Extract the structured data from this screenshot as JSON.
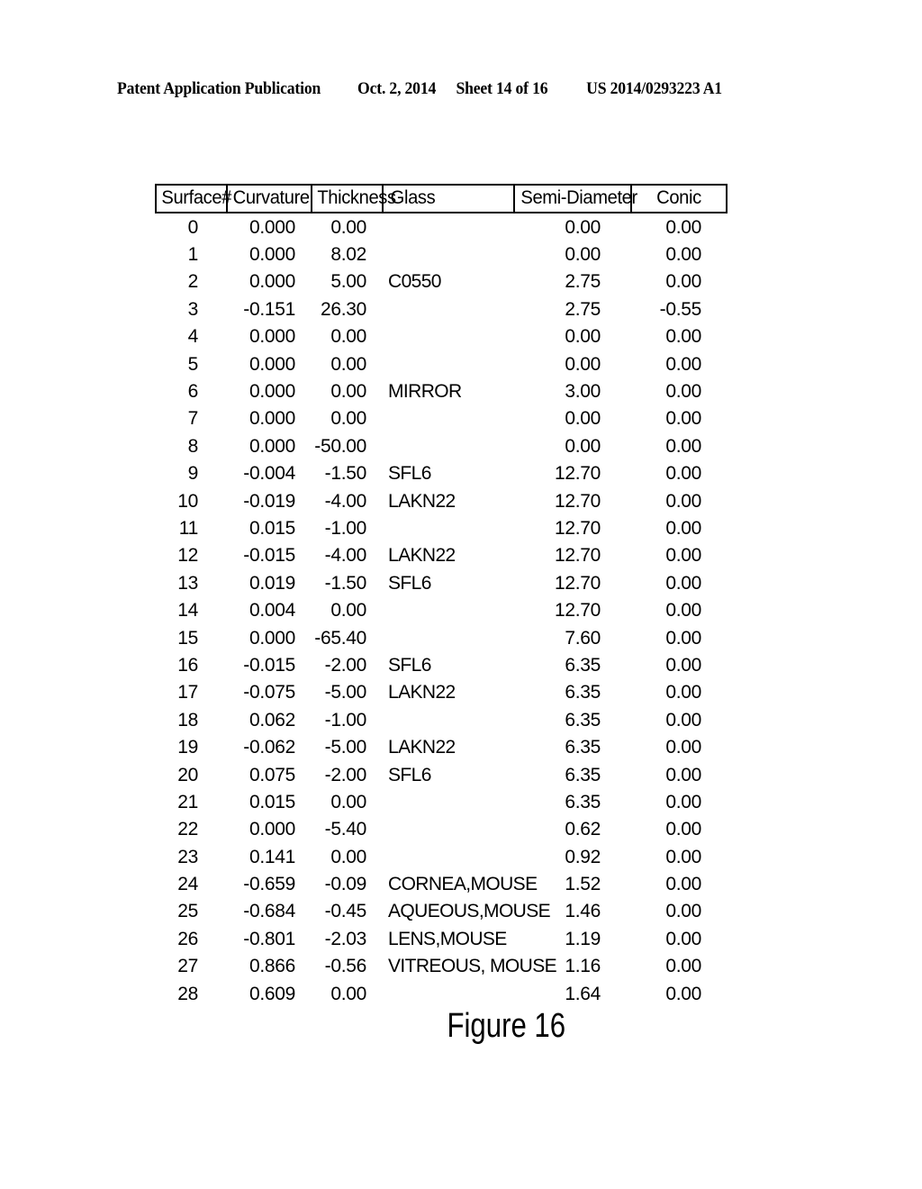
{
  "page": {
    "header": {
      "publication": "Patent Application Publication",
      "date": "Oct. 2, 2014",
      "sheet": "Sheet 14 of 16",
      "publication_number": "US 2014/0293223 A1"
    },
    "figure_caption": "Figure 16"
  },
  "table": {
    "columns": [
      "Surface#",
      "Curvature",
      "Thickness",
      "Glass",
      "Semi-Diameter",
      "Conic"
    ],
    "rows": [
      {
        "surface": "0",
        "curvature": "0.000",
        "thickness": "0.00",
        "glass": "",
        "semi_diameter": "0.00",
        "conic": "0.00"
      },
      {
        "surface": "1",
        "curvature": "0.000",
        "thickness": "8.02",
        "glass": "",
        "semi_diameter": "0.00",
        "conic": "0.00"
      },
      {
        "surface": "2",
        "curvature": "0.000",
        "thickness": "5.00",
        "glass": "C0550",
        "semi_diameter": "2.75",
        "conic": "0.00"
      },
      {
        "surface": "3",
        "curvature": "-0.151",
        "thickness": "26.30",
        "glass": "",
        "semi_diameter": "2.75",
        "conic": "-0.55"
      },
      {
        "surface": "4",
        "curvature": "0.000",
        "thickness": "0.00",
        "glass": "",
        "semi_diameter": "0.00",
        "conic": "0.00"
      },
      {
        "surface": "5",
        "curvature": "0.000",
        "thickness": "0.00",
        "glass": "",
        "semi_diameter": "0.00",
        "conic": "0.00"
      },
      {
        "surface": "6",
        "curvature": "0.000",
        "thickness": "0.00",
        "glass": "MIRROR",
        "semi_diameter": "3.00",
        "conic": "0.00"
      },
      {
        "surface": "7",
        "curvature": "0.000",
        "thickness": "0.00",
        "glass": "",
        "semi_diameter": "0.00",
        "conic": "0.00"
      },
      {
        "surface": "8",
        "curvature": "0.000",
        "thickness": "-50.00",
        "glass": "",
        "semi_diameter": "0.00",
        "conic": "0.00"
      },
      {
        "surface": "9",
        "curvature": "-0.004",
        "thickness": "-1.50",
        "glass": "SFL6",
        "semi_diameter": "12.70",
        "conic": "0.00"
      },
      {
        "surface": "10",
        "curvature": "-0.019",
        "thickness": "-4.00",
        "glass": "LAKN22",
        "semi_diameter": "12.70",
        "conic": "0.00"
      },
      {
        "surface": "11",
        "curvature": "0.015",
        "thickness": "-1.00",
        "glass": "",
        "semi_diameter": "12.70",
        "conic": "0.00"
      },
      {
        "surface": "12",
        "curvature": "-0.015",
        "thickness": "-4.00",
        "glass": "LAKN22",
        "semi_diameter": "12.70",
        "conic": "0.00"
      },
      {
        "surface": "13",
        "curvature": "0.019",
        "thickness": "-1.50",
        "glass": "SFL6",
        "semi_diameter": "12.70",
        "conic": "0.00"
      },
      {
        "surface": "14",
        "curvature": "0.004",
        "thickness": "0.00",
        "glass": "",
        "semi_diameter": "12.70",
        "conic": "0.00"
      },
      {
        "surface": "15",
        "curvature": "0.000",
        "thickness": "-65.40",
        "glass": "",
        "semi_diameter": "7.60",
        "conic": "0.00"
      },
      {
        "surface": "16",
        "curvature": "-0.015",
        "thickness": "-2.00",
        "glass": "SFL6",
        "semi_diameter": "6.35",
        "conic": "0.00"
      },
      {
        "surface": "17",
        "curvature": "-0.075",
        "thickness": "-5.00",
        "glass": "LAKN22",
        "semi_diameter": "6.35",
        "conic": "0.00"
      },
      {
        "surface": "18",
        "curvature": "0.062",
        "thickness": "-1.00",
        "glass": "",
        "semi_diameter": "6.35",
        "conic": "0.00"
      },
      {
        "surface": "19",
        "curvature": "-0.062",
        "thickness": "-5.00",
        "glass": "LAKN22",
        "semi_diameter": "6.35",
        "conic": "0.00"
      },
      {
        "surface": "20",
        "curvature": "0.075",
        "thickness": "-2.00",
        "glass": "SFL6",
        "semi_diameter": "6.35",
        "conic": "0.00"
      },
      {
        "surface": "21",
        "curvature": "0.015",
        "thickness": "0.00",
        "glass": "",
        "semi_diameter": "6.35",
        "conic": "0.00"
      },
      {
        "surface": "22",
        "curvature": "0.000",
        "thickness": "-5.40",
        "glass": "",
        "semi_diameter": "0.62",
        "conic": "0.00"
      },
      {
        "surface": "23",
        "curvature": "0.141",
        "thickness": "0.00",
        "glass": "",
        "semi_diameter": "0.92",
        "conic": "0.00"
      },
      {
        "surface": "24",
        "curvature": "-0.659",
        "thickness": "-0.09",
        "glass": "CORNEA,MOUSE",
        "semi_diameter": "1.52",
        "conic": "0.00"
      },
      {
        "surface": "25",
        "curvature": "-0.684",
        "thickness": "-0.45",
        "glass": "AQUEOUS,MOUSE",
        "semi_diameter": "1.46",
        "conic": "0.00"
      },
      {
        "surface": "26",
        "curvature": "-0.801",
        "thickness": "-2.03",
        "glass": "LENS,MOUSE",
        "semi_diameter": "1.19",
        "conic": "0.00"
      },
      {
        "surface": "27",
        "curvature": "0.866",
        "thickness": "-0.56",
        "glass": "VITREOUS, MOUSE",
        "semi_diameter": "1.16",
        "conic": "0.00"
      },
      {
        "surface": "28",
        "curvature": "0.609",
        "thickness": "0.00",
        "glass": "",
        "semi_diameter": "1.64",
        "conic": "0.00"
      }
    ]
  }
}
